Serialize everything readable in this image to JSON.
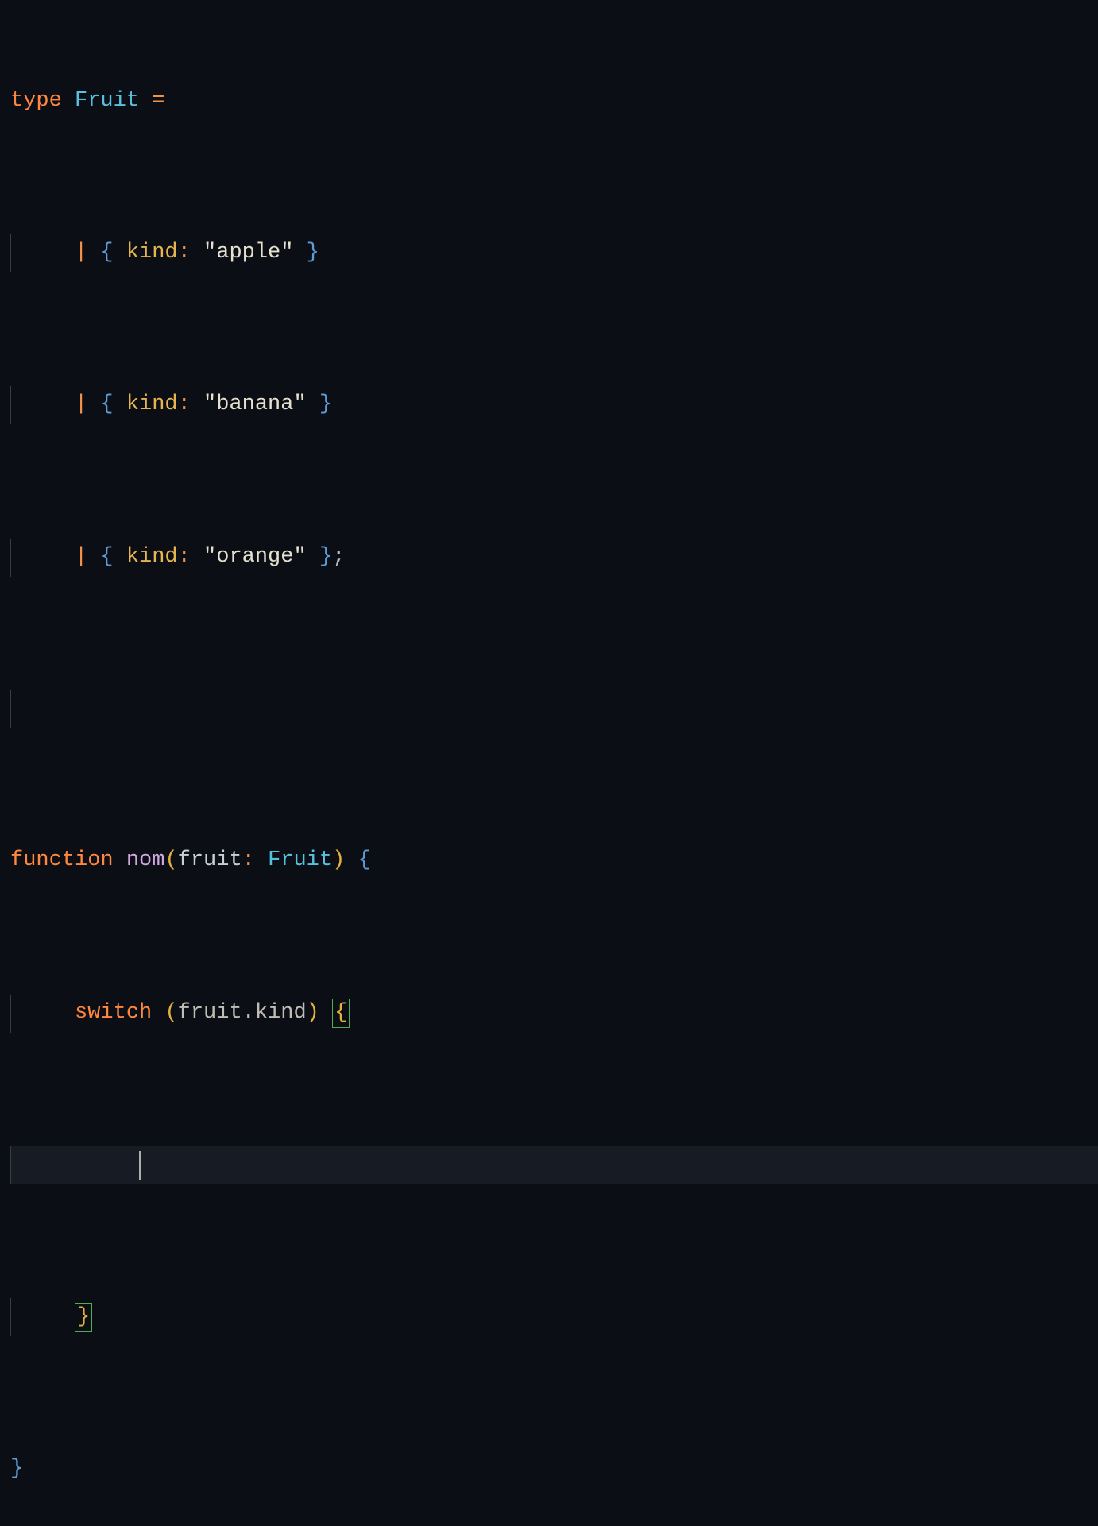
{
  "code": {
    "line1": {
      "type_kw": "type",
      "type_name": "Fruit",
      "equals": "="
    },
    "line2": {
      "pipe": "|",
      "lbrace": "{",
      "prop": "kind",
      "colon": ":",
      "value": "\"apple\"",
      "rbrace": "}"
    },
    "line3": {
      "pipe": "|",
      "lbrace": "{",
      "prop": "kind",
      "colon": ":",
      "value": "\"banana\"",
      "rbrace": "}"
    },
    "line4": {
      "pipe": "|",
      "lbrace": "{",
      "prop": "kind",
      "colon": ":",
      "value": "\"orange\"",
      "rbrace": "}",
      "semi": ";"
    },
    "line6": {
      "function_kw": "function",
      "func_name": "nom",
      "lparen": "(",
      "param": "fruit",
      "colon": ":",
      "param_type": "Fruit",
      "rparen": ")",
      "lbrace": "{"
    },
    "line7": {
      "switch_kw": "switch",
      "lparen": "(",
      "obj": "fruit",
      "dot": ".",
      "prop": "kind",
      "rparen": ")",
      "lbrace": "{"
    },
    "line9": {
      "rbrace": "}"
    },
    "line10": {
      "rbrace": "}"
    }
  }
}
